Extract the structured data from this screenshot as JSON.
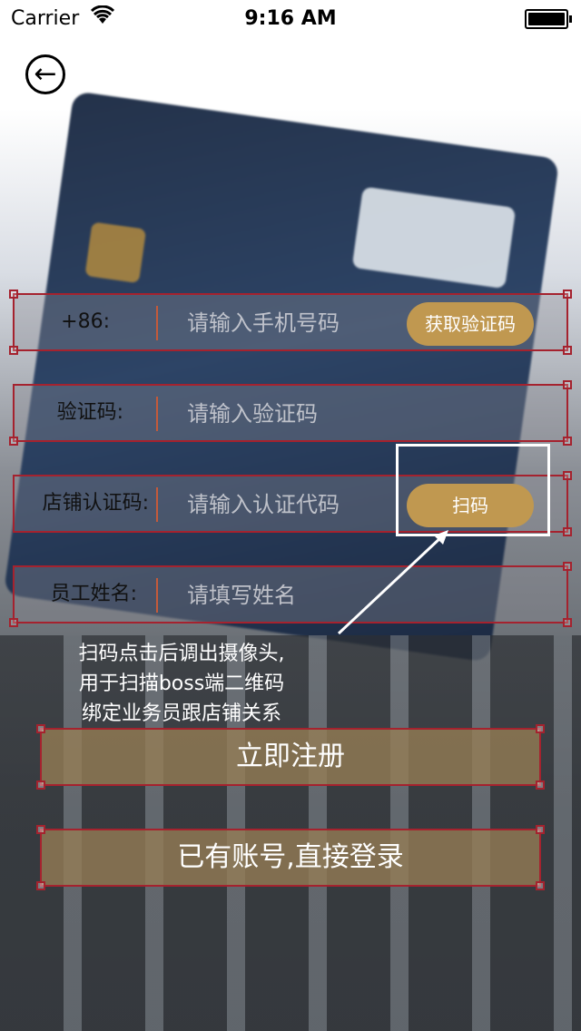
{
  "status_bar": {
    "carrier": "Carrier",
    "time": "9:16 AM"
  },
  "form": {
    "phone": {
      "label": "+86:",
      "placeholder": "请输入手机号码",
      "button": "获取验证码"
    },
    "code": {
      "label": "验证码:",
      "placeholder": "请输入验证码"
    },
    "store_code": {
      "label": "店铺认证码:",
      "placeholder": "请输入认证代码",
      "button": "扫码"
    },
    "name": {
      "label": "员工姓名:",
      "placeholder": "请填写姓名"
    }
  },
  "annotation": {
    "lines": [
      "扫码点击后调出摄像头,",
      "用于扫描boss端二维码",
      "绑定业务员跟店铺关系"
    ]
  },
  "actions": {
    "register": "立即注册",
    "login": "已有账号,直接登录"
  },
  "colors": {
    "accent_gold": "#c09850",
    "border_red": "#a5222e"
  }
}
